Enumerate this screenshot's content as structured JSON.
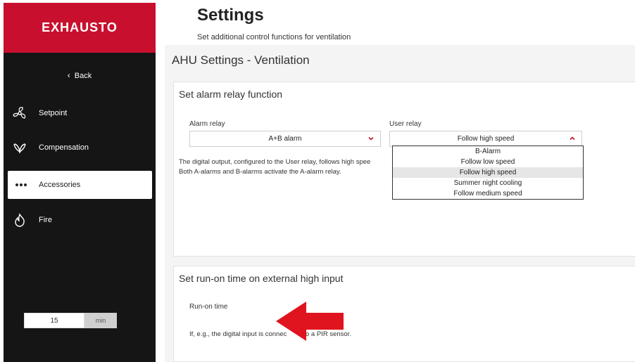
{
  "brand": {
    "name": "EXHAUSTO",
    "color": "#c8102e"
  },
  "header": {
    "title": "Settings",
    "subtitle": "Set additional control functions for ventilation"
  },
  "sidebar": {
    "back_label": "Back",
    "items": [
      {
        "label": "Setpoint",
        "icon": "fan-icon"
      },
      {
        "label": "Compensation",
        "icon": "leaf-icon"
      },
      {
        "label": "Accessories",
        "icon": "dots-icon",
        "active": true
      },
      {
        "label": "Fire",
        "icon": "flame-icon"
      }
    ]
  },
  "main": {
    "section_title": "AHU Settings - Ventilation",
    "alarm_card": {
      "title": "Set alarm relay function",
      "alarm_relay": {
        "label": "Alarm relay",
        "value": "A+B alarm"
      },
      "user_relay": {
        "label": "User relay",
        "value": "Follow high speed",
        "options": [
          "B-Alarm",
          "Follow low speed",
          "Follow high speed",
          "Summer night cooling",
          "Follow medium speed"
        ],
        "selected_index": 2
      },
      "description_line1": "The digital output, configured to the User relay, follows high spee",
      "description_line2": "Both A-alarms and B-alarms activate the A-alarm relay."
    },
    "runon_card": {
      "title": "Set run-on time on external high input",
      "label": "Run-on time",
      "value": "15",
      "unit": "min",
      "note_start": "If, e.g., the digital input is connec",
      "note_end": "to a PIR sensor."
    }
  },
  "colors": {
    "accent": "#c8102e",
    "sidebar_bg": "#151515",
    "annotation_arrow": "#e0141e"
  }
}
